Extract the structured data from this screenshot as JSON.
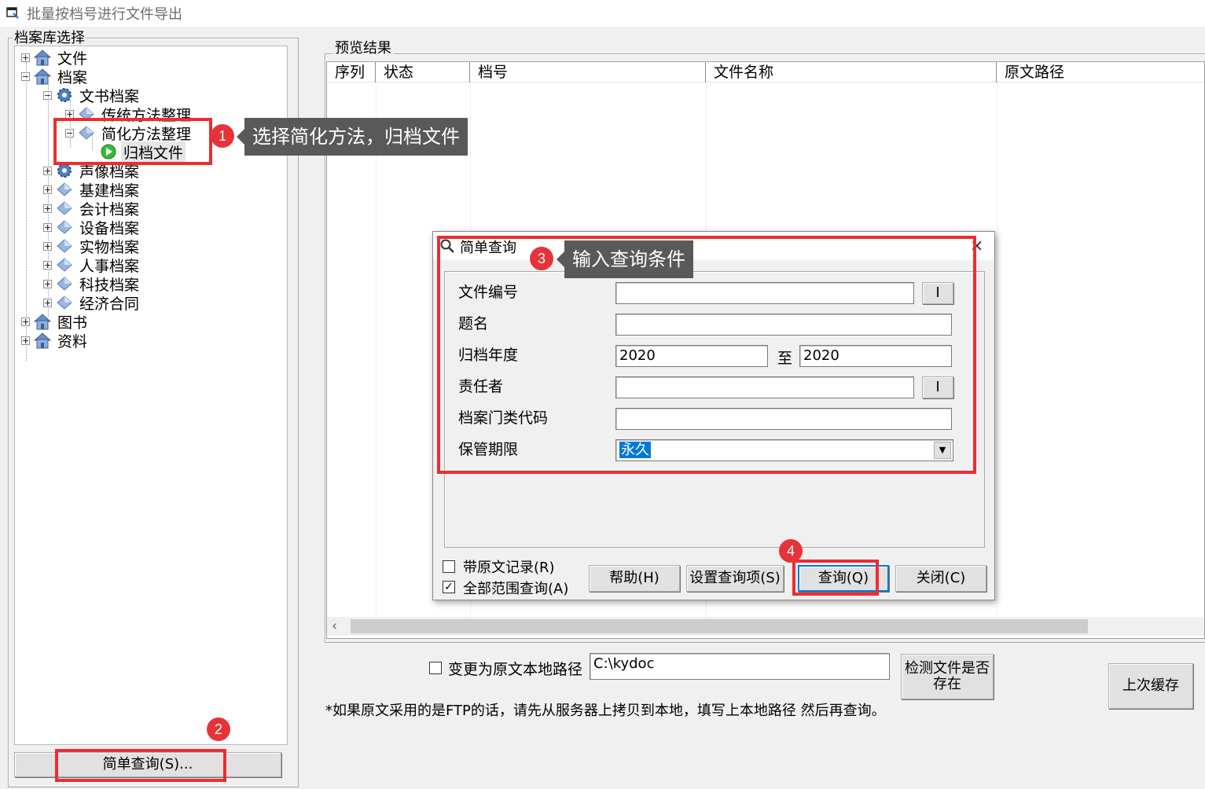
{
  "window": {
    "title": "批量按档号进行文件导出"
  },
  "left_panel": {
    "group_title": "档案库选择",
    "tree": [
      {
        "label": "文件",
        "icon": "house-icon",
        "expander": "plus"
      },
      {
        "label": "档案",
        "icon": "house-icon",
        "expander": "minus"
      },
      {
        "label": "文书档案",
        "icon": "gear-icon",
        "expander": "minus"
      },
      {
        "label": "传统方法整理",
        "icon": "diamond-icon",
        "expander": "plus"
      },
      {
        "label": "简化方法整理",
        "icon": "diamond-icon",
        "expander": "minus"
      },
      {
        "label": "归档文件",
        "icon": "green-play-icon",
        "expander": "none",
        "selected": true
      },
      {
        "label": "声像档案",
        "icon": "gear-icon",
        "expander": "plus"
      },
      {
        "label": "基建档案",
        "icon": "diamond-icon",
        "expander": "plus"
      },
      {
        "label": "会计档案",
        "icon": "diamond-icon",
        "expander": "plus"
      },
      {
        "label": "设备档案",
        "icon": "diamond-icon",
        "expander": "plus"
      },
      {
        "label": "实物档案",
        "icon": "diamond-icon",
        "expander": "plus"
      },
      {
        "label": "人事档案",
        "icon": "diamond-icon",
        "expander": "plus"
      },
      {
        "label": "科技档案",
        "icon": "diamond-icon",
        "expander": "plus"
      },
      {
        "label": "经济合同",
        "icon": "diamond-icon",
        "expander": "plus"
      },
      {
        "label": "图书",
        "icon": "house-icon",
        "expander": "plus"
      },
      {
        "label": "资料",
        "icon": "house-icon",
        "expander": "plus"
      }
    ],
    "simple_query_button": "简单查询(S)..."
  },
  "preview": {
    "group_title": "预览结果",
    "columns": [
      "序列",
      "状态",
      "档号",
      "文件名称",
      "原文路径"
    ]
  },
  "bottom": {
    "change_path_label": "变更为原文本地路径",
    "change_path_checked": false,
    "path_value": "C:\\kydoc",
    "check_files_button": "检测文件是否存在",
    "last_cache_button": "上次缓存",
    "ftp_note": "*如果原文采用的是FTP的话，请先从服务器上拷贝到本地，填写上本地路径 然后再查询。"
  },
  "dialog": {
    "title": "简单查询",
    "fields": {
      "file_number": {
        "label": "文件编号",
        "value": "",
        "button": "I"
      },
      "title": {
        "label": "题名",
        "value": ""
      },
      "year": {
        "label": "归档年度",
        "from": "2020",
        "sep": "至",
        "to": "2020"
      },
      "responsible": {
        "label": "责任者",
        "value": "",
        "button": "I"
      },
      "category_code": {
        "label": "档案门类代码",
        "value": ""
      },
      "retention": {
        "label": "保管期限",
        "value": "永久"
      }
    },
    "with_original_label": "带原文记录(R)",
    "with_original_checked": false,
    "all_scope_label": "全部范围查询(A)",
    "all_scope_checked": true,
    "buttons": {
      "help": "帮助(H)",
      "settings": "设置查询项(S)",
      "query": "查询(Q)",
      "close": "关闭(C)"
    }
  },
  "annotations": {
    "badge1": "1",
    "callout1": "选择简化方法，归档文件",
    "badge2": "2",
    "badge3": "3",
    "callout3": "输入查询条件",
    "badge4": "4",
    "accent_color": "#ec2d31",
    "callout_bg": "#595959"
  }
}
